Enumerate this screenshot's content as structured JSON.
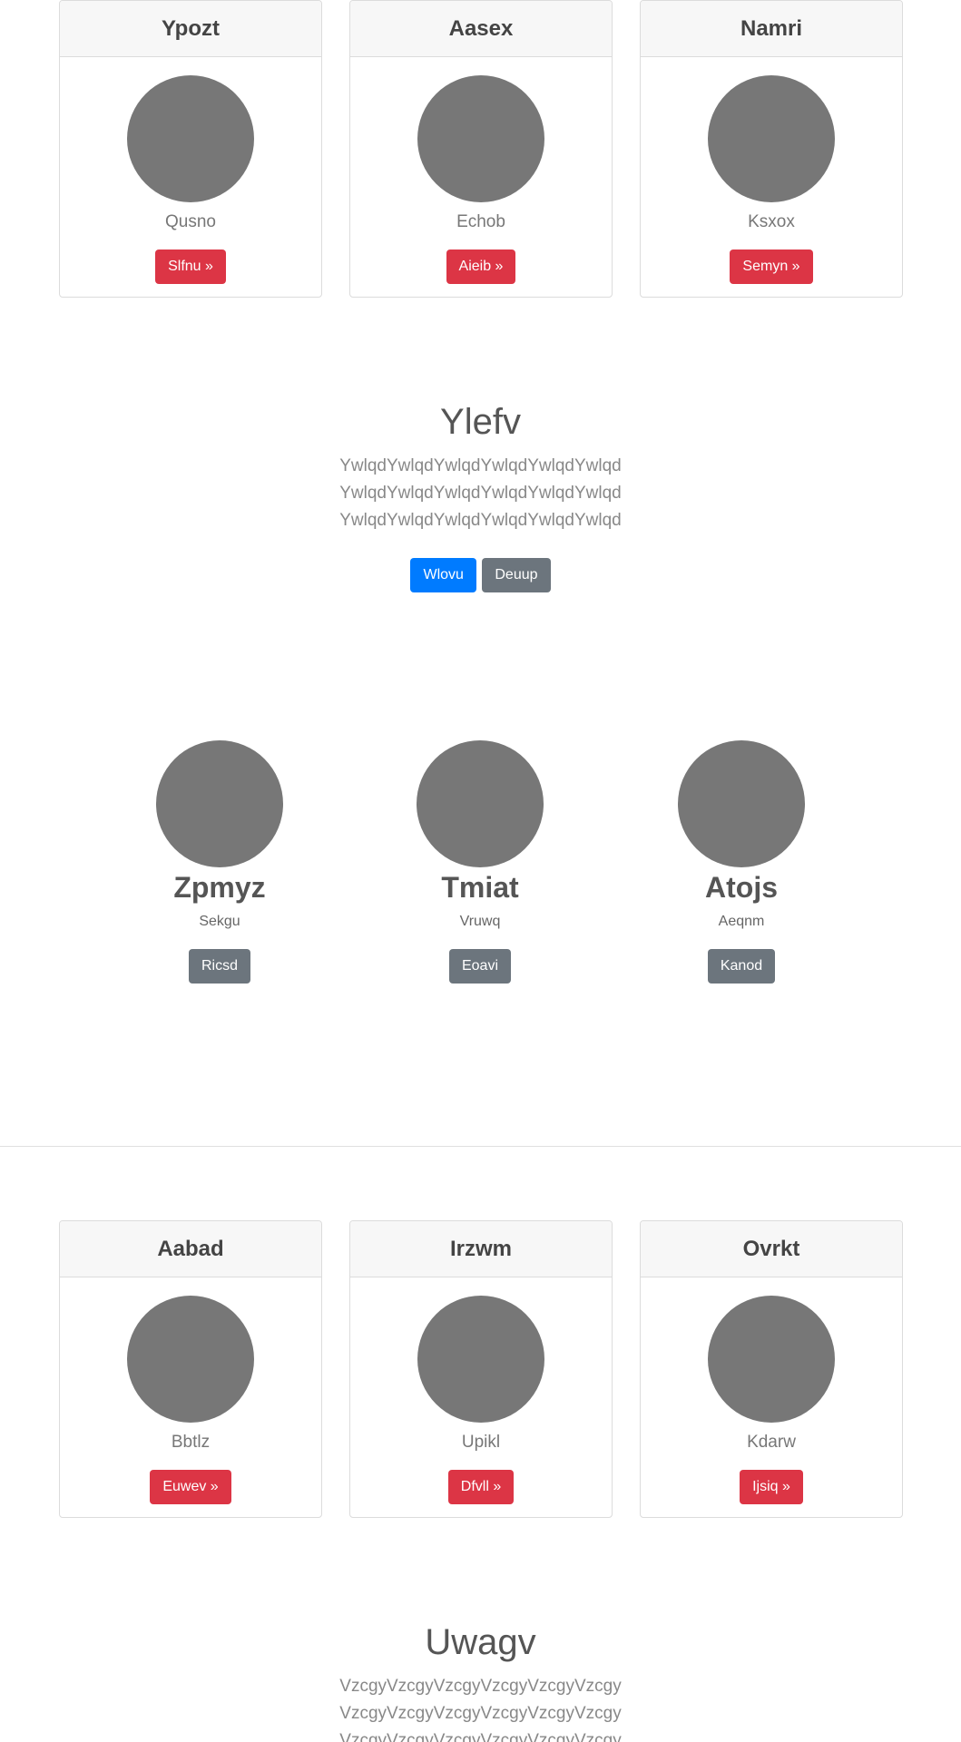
{
  "cards_top": [
    {
      "title": "Ypozt",
      "subtitle": "Qusno",
      "button": "Slfnu »"
    },
    {
      "title": "Aasex",
      "subtitle": "Echob",
      "button": "Aieib »"
    },
    {
      "title": "Namri",
      "subtitle": "Ksxox",
      "button": "Semyn »"
    }
  ],
  "hero1": {
    "title": "Ylefv",
    "text": "YwlqdYwlqdYwlqdYwlqdYwlqdYwlqdYwlqdYwlqdYwlqdYwlqdYwlqdYwlqdYwlqdYwlqdYwlqdYwlqdYwlqdYwlqd",
    "primary_button": "Wlovu",
    "secondary_button": "Deuup"
  },
  "features": [
    {
      "title": "Zpmyz",
      "subtitle": "Sekgu",
      "button": "Ricsd"
    },
    {
      "title": "Tmiat",
      "subtitle": "Vruwq",
      "button": "Eoavi"
    },
    {
      "title": "Atojs",
      "subtitle": "Aeqnm",
      "button": "Kanod"
    }
  ],
  "cards_bottom": [
    {
      "title": "Aabad",
      "subtitle": "Bbtlz",
      "button": "Euwev »"
    },
    {
      "title": "Irzwm",
      "subtitle": "Upikl",
      "button": "Dfvll »"
    },
    {
      "title": "Ovrkt",
      "subtitle": "Kdarw",
      "button": "Ijsiq »"
    }
  ],
  "hero2": {
    "title": "Uwagv",
    "text": "VzcgyVzcgyVzcgyVzcgyVzcgyVzcgyVzcgyVzcgyVzcgyVzcgyVzcgyVzcgyVzcgyVzcgyVzcgyVzcgyVzcgyVzcgy"
  },
  "colors": {
    "danger": "#dc3545",
    "primary": "#007bff",
    "secondary": "#6c757d",
    "avatar": "#777777"
  }
}
